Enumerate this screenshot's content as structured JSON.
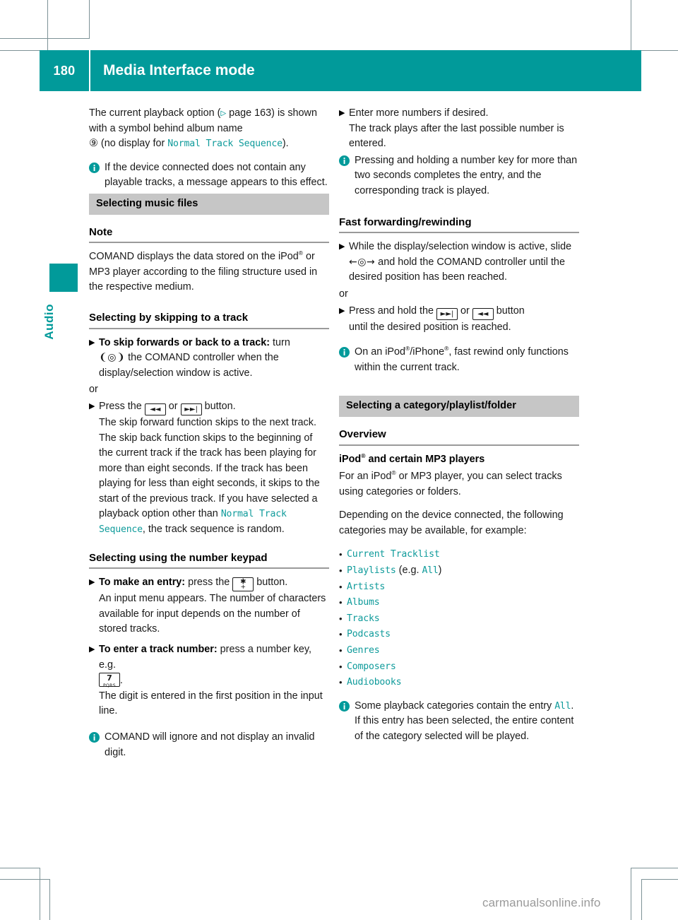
{
  "header": {
    "page_number": "180",
    "title": "Media Interface mode",
    "accent_color": "#019a9a"
  },
  "sidebar": {
    "tab_label": "Audio",
    "tab_color": "#019a9a"
  },
  "left_column": {
    "intro": {
      "line1": "The current playback option (",
      "page_ref_arrow": "▷",
      "page_ref": " page 163) is",
      "line2": "shown with a symbol behind album name",
      "symbol": "⑨",
      "line3_pre": " (no display for ",
      "line3_mono": "Normal Track Sequence",
      "line3_post": ")."
    },
    "note_no_tracks": "If the device connected does not contain any playable tracks, a message appears to this effect.",
    "section_selecting_music_files": "Selecting music files",
    "note_head": "Note",
    "note_paragraph_pre": "COMAND displays the data stored on the iPod",
    "note_paragraph_post": " or MP3 player according to the filing structure used in the respective medium.",
    "skipping_head": "Selecting by skipping to a track",
    "skip_step_bold": "To skip forwards or back to a track:",
    "skip_step_rest": " turn",
    "skip_glyph": "❨◎❩",
    "skip_step_cont": " the COMAND controller when the display/selection window is active.",
    "or": "or",
    "press_button_pre": "Press the ",
    "press_button_mid": " or ",
    "press_button_post": " button.",
    "skip_explanation_pre": "The skip forward function skips to the next track. The skip back function skips to the beginning of the current track if the track has been playing for more than eight seconds. If the track has been playing for less than eight seconds, it skips to the start of the previous track. If you have selected a playback option other than ",
    "skip_explanation_mono": "Normal Track Sequence",
    "skip_explanation_post": ", the track sequence is random.",
    "keypad_head": "Selecting using the number keypad",
    "entry_step_bold": "To make an entry:",
    "entry_step_mid": " press the ",
    "entry_step_post": " button.",
    "entry_step_cont": "An input menu appears. The number of characters available for input depends on the number of stored tracks.",
    "track_number_bold": "To enter a track number:",
    "track_number_rest": " press a number key, e.g. ",
    "track_number_period": ".",
    "track_number_cont": "The digit is entered in the first position in the input line.",
    "note_invalid_digit": "COMAND will ignore and not display an invalid digit.",
    "key_skip_back": "◄◄",
    "key_skip_fwd": "►►|",
    "key_star_top": "✱",
    "key_star_bottom": "+",
    "key_seven_digit": "7",
    "key_seven_letters": "PQRS"
  },
  "right_column": {
    "enter_more_numbers": "Enter more numbers if desired.",
    "enter_more_cont": "The track plays after the last possible number is entered.",
    "note_hold_key": "Pressing and holding a number key for more than two seconds completes the entry, and the corresponding track is played.",
    "fast_fwd_head": "Fast forwarding/rewinding",
    "ff_step_pre": "While the display/selection window is active, slide ",
    "ff_glyph": "←◎→",
    "ff_step_post": " and hold the COMAND controller until the desired position has been reached.",
    "or": "or",
    "ff_press_pre": "Press and hold the ",
    "ff_press_mid": " or ",
    "ff_press_post": " button",
    "ff_press_cont": "until the desired position is reached.",
    "note_ipod_rewind_pre": "On an iPod",
    "note_ipod_rewind_mid": "/iPhone",
    "note_ipod_rewind_post": ", fast rewind only functions within the current track.",
    "section_selecting_category": "Selecting a category/playlist/folder",
    "overview_head": "Overview",
    "ipod_head_pre": "iPod",
    "ipod_head_post": " and certain MP3 players",
    "ipod_para_pre": "For an iPod",
    "ipod_para_post": " or MP3 player, you can select tracks using categories or folders.",
    "depending_para": "Depending on the device connected, the following categories may be available, for example:",
    "categories": [
      {
        "name": "Current Tracklist",
        "suffix_pre": "",
        "suffix_mono": "",
        "suffix_post": ""
      },
      {
        "name": "Playlists",
        "suffix_pre": " (e.g. ",
        "suffix_mono": "All",
        "suffix_post": ")"
      },
      {
        "name": "Artists",
        "suffix_pre": "",
        "suffix_mono": "",
        "suffix_post": ""
      },
      {
        "name": "Albums",
        "suffix_pre": "",
        "suffix_mono": "",
        "suffix_post": ""
      },
      {
        "name": "Tracks",
        "suffix_pre": "",
        "suffix_mono": "",
        "suffix_post": ""
      },
      {
        "name": "Podcasts",
        "suffix_pre": "",
        "suffix_mono": "",
        "suffix_post": ""
      },
      {
        "name": "Genres",
        "suffix_pre": "",
        "suffix_mono": "",
        "suffix_post": ""
      },
      {
        "name": "Composers",
        "suffix_pre": "",
        "suffix_mono": "",
        "suffix_post": ""
      },
      {
        "name": "Audiobooks",
        "suffix_pre": "",
        "suffix_mono": "",
        "suffix_post": ""
      }
    ],
    "note_all_entry_pre": "Some playback categories contain the entry ",
    "note_all_entry_mono": "All",
    "note_all_entry_post": ". If this entry has been selected, the entire content of the category selected will be played."
  },
  "watermark": "carmanualsonline.info",
  "glyphs": {
    "step_marker": "▶",
    "bullet_marker": "•",
    "registered": "®"
  }
}
